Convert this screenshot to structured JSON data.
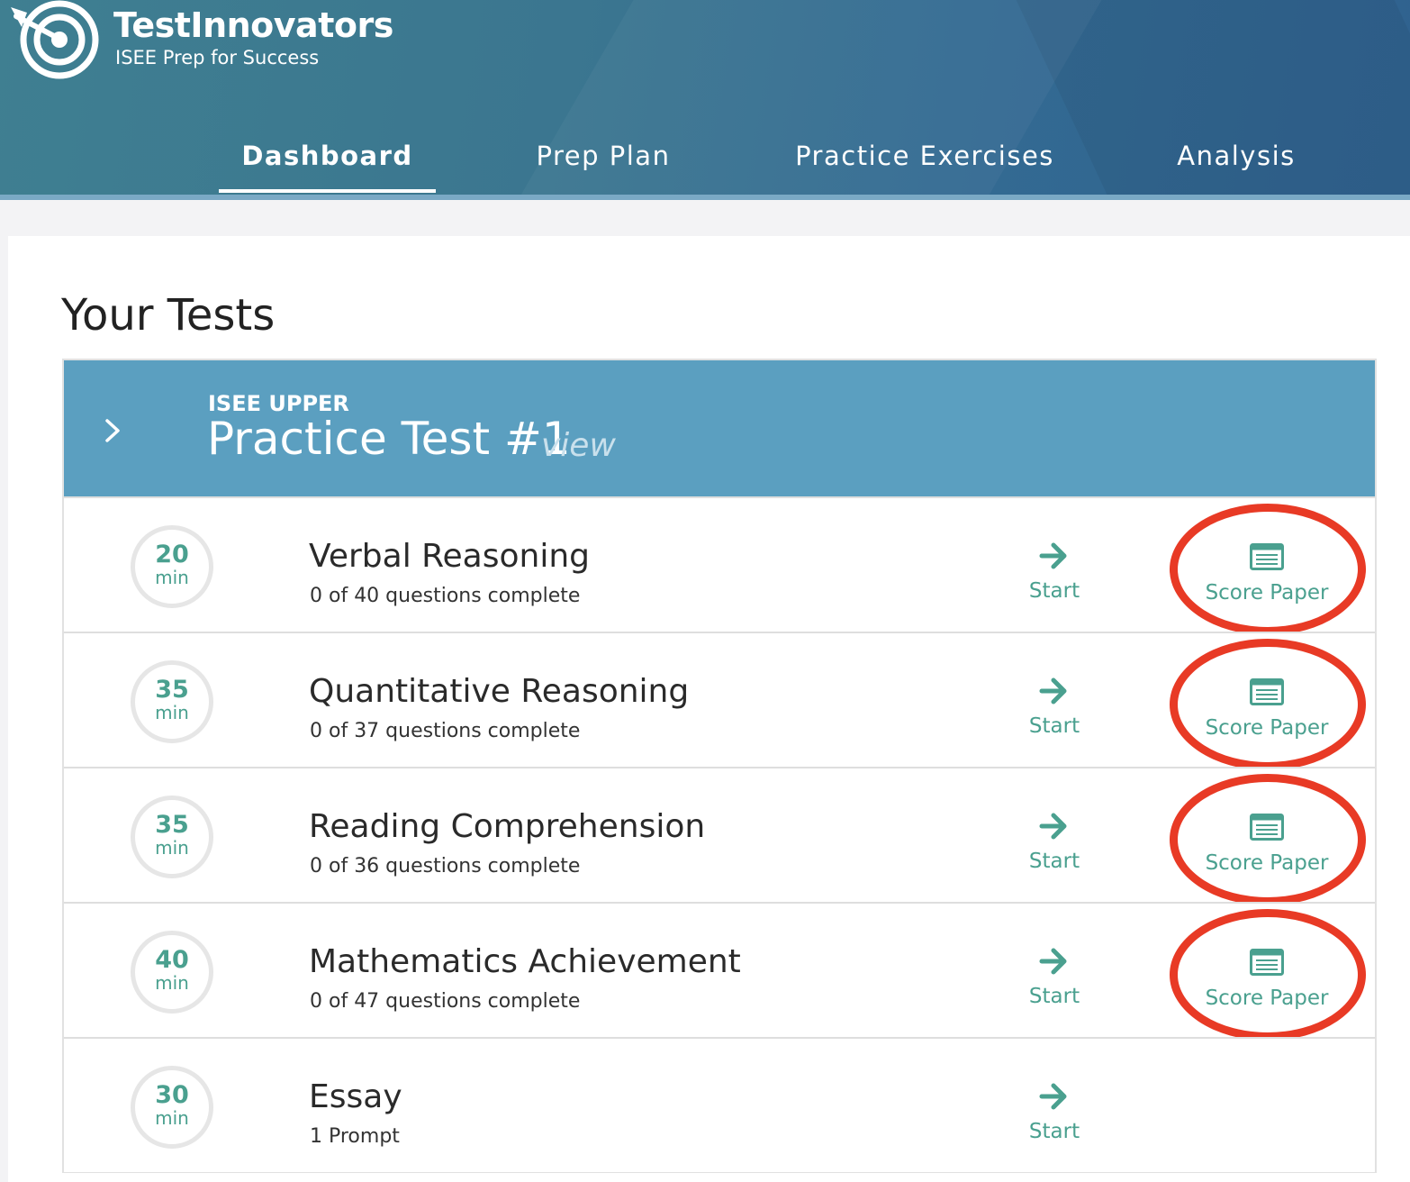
{
  "brand": {
    "name": "TestInnovators",
    "tagline": "ISEE Prep for Success"
  },
  "nav": {
    "items": [
      {
        "label": "Dashboard",
        "active": true
      },
      {
        "label": "Prep Plan",
        "active": false
      },
      {
        "label": "Practice Exercises",
        "active": false
      },
      {
        "label": "Analysis",
        "active": false
      }
    ]
  },
  "main": {
    "title": "Your Tests",
    "test": {
      "level": "ISEE UPPER",
      "name": "Practice Test #1",
      "view_label": "view",
      "sections": [
        {
          "minutes": "20",
          "unit": "min",
          "name": "Verbal Reasoning",
          "progress": "0 of 40 questions complete",
          "start_label": "Start",
          "score_label": "Score Paper",
          "has_score_paper": true
        },
        {
          "minutes": "35",
          "unit": "min",
          "name": "Quantitative Reasoning",
          "progress": "0 of 37 questions complete",
          "start_label": "Start",
          "score_label": "Score Paper",
          "has_score_paper": true
        },
        {
          "minutes": "35",
          "unit": "min",
          "name": "Reading Comprehension",
          "progress": "0 of 36 questions complete",
          "start_label": "Start",
          "score_label": "Score Paper",
          "has_score_paper": true
        },
        {
          "minutes": "40",
          "unit": "min",
          "name": "Mathematics Achievement",
          "progress": "0 of 47 questions complete",
          "start_label": "Start",
          "score_label": "Score Paper",
          "has_score_paper": true
        },
        {
          "minutes": "30",
          "unit": "min",
          "name": "Essay",
          "progress": "1 Prompt",
          "start_label": "Start",
          "has_score_paper": false
        }
      ]
    }
  },
  "colors": {
    "header": "#3b7690",
    "test_header": "#5b9fc0",
    "accent_green": "#4aa08f",
    "annotation_red": "#e83a25"
  },
  "icons": {
    "logo": "target-arrow-icon",
    "expand": "chevron-right-icon",
    "start": "arrow-right-icon",
    "score": "score-sheet-icon"
  }
}
